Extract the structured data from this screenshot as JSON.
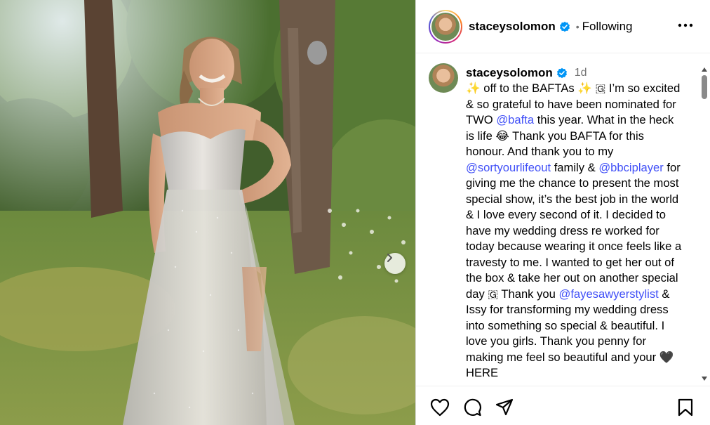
{
  "post": {
    "username": "staceysolomon",
    "following_label": "Following",
    "separator": "•",
    "time_ago": "1d"
  },
  "caption": {
    "segments": [
      {
        "text": "✨ off to the BAFTAs ✨ 🇬 I’m so excited & so grateful to have been nominated for TWO ",
        "type": "text"
      },
      {
        "text": "@bafta",
        "type": "mention"
      },
      {
        "text": " this year. What in the heck is life 😂 Thank you BAFTA for this honour. And thank you to my ",
        "type": "text"
      },
      {
        "text": "@sortyourlifeout",
        "type": "mention"
      },
      {
        "text": " family & ",
        "type": "text"
      },
      {
        "text": "@bbciplayer",
        "type": "mention"
      },
      {
        "text": " for giving me the chance to present the most special show, it’s the best job in the world & I love every second of it. I decided to have my wedding dress re worked for today because wearing it once feels like a travesty to me. I wanted to get her out of the box & take her out on another special day 🇬 Thank you ",
        "type": "text"
      },
      {
        "text": "@fayesawyerstylist",
        "type": "mention"
      },
      {
        "text": " & Issy for transforming my wedding dress into something so special & beautiful. I love you girls. Thank you penny for making me feel so beautiful and your 🖤 HERE",
        "type": "text"
      }
    ]
  },
  "colors": {
    "mention": "#4150f7",
    "verified": "#0095f6",
    "muted": "#737373"
  },
  "icons": [
    "heart-icon",
    "comment-icon",
    "share-icon",
    "bookmark-icon",
    "more-icon",
    "verified-badge-icon",
    "chevron-right-icon"
  ]
}
